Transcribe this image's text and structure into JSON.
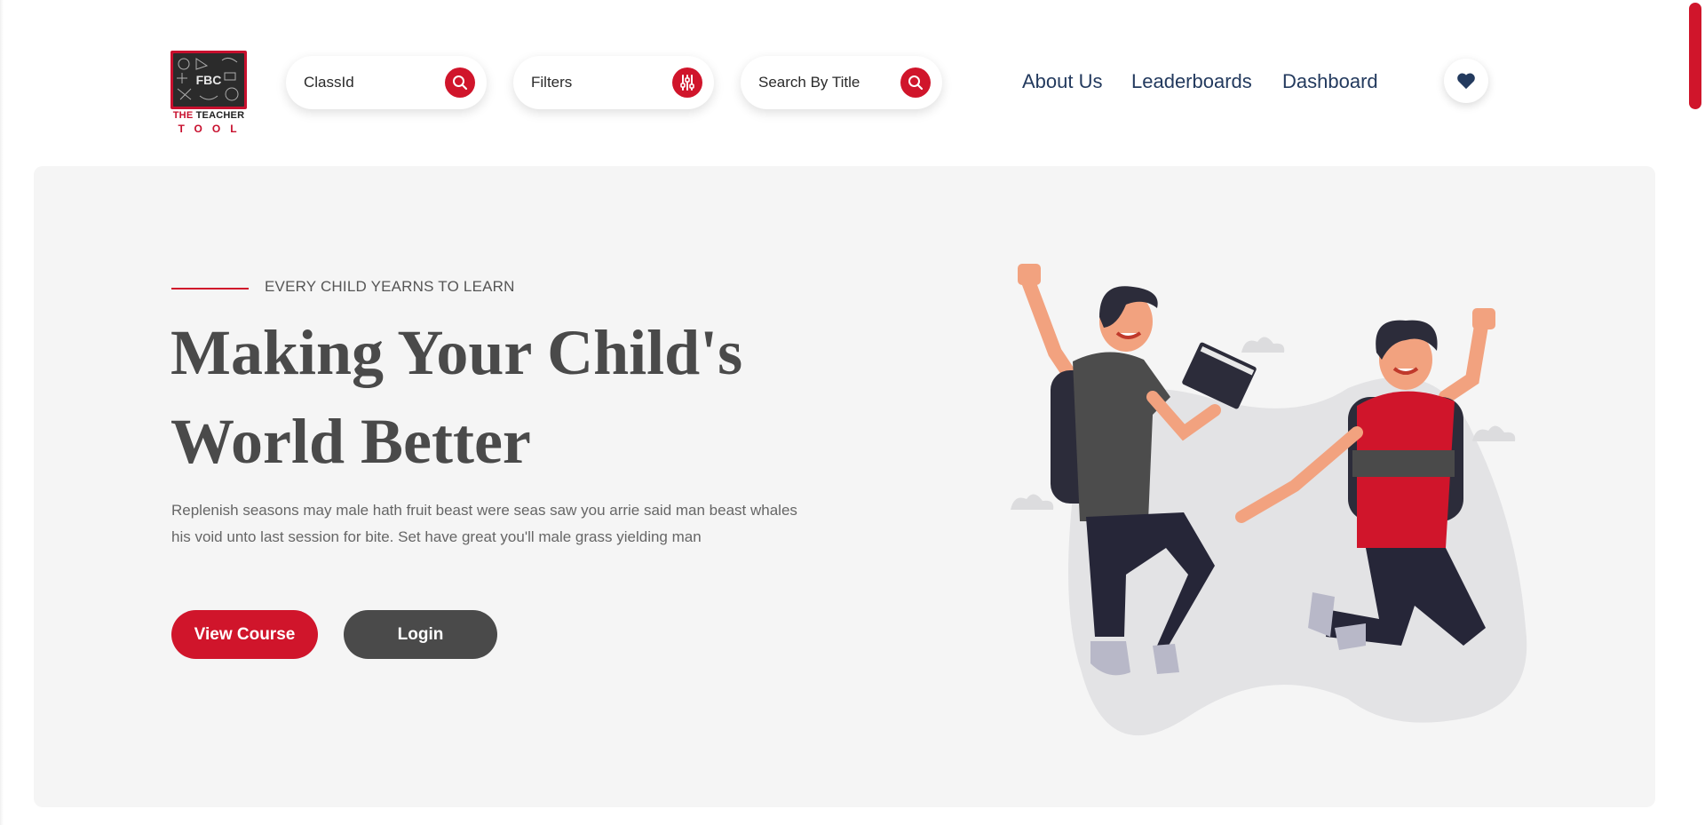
{
  "brand": {
    "logo_line1_red": "THE",
    "logo_line1_dark": "TEACHER",
    "logo_line2": "TOOL",
    "board_text": "FBC"
  },
  "search": {
    "class_id_label": "ClassId",
    "filters_label": "Filters",
    "title_label": "Search By Title",
    "class_icon": "search-icon",
    "filters_icon": "sliders-icon",
    "title_icon": "search-icon"
  },
  "nav": {
    "items": [
      {
        "label": "About Us"
      },
      {
        "label": "Leaderboards"
      },
      {
        "label": "Dashboard"
      }
    ],
    "favorites_icon": "heart-icon"
  },
  "hero": {
    "eyebrow": "EVERY CHILD YEARNS TO LEARN",
    "headline_line1": "Making Your Child's",
    "headline_line2": "World Better",
    "paragraph_line1": "Replenish seasons may male hath fruit beast were seas saw you arrie said man beast whales",
    "paragraph_line2": "his void unto last session for bite. Set have great you'll male grass yielding man",
    "view_course_label": "View Course",
    "login_label": "Login",
    "illustration": "two-students-jumping"
  },
  "colors": {
    "accent": "#d0152b",
    "nav_text": "#233a5e",
    "dark_button": "#4a4a4a",
    "hero_bg": "#f5f5f5"
  }
}
